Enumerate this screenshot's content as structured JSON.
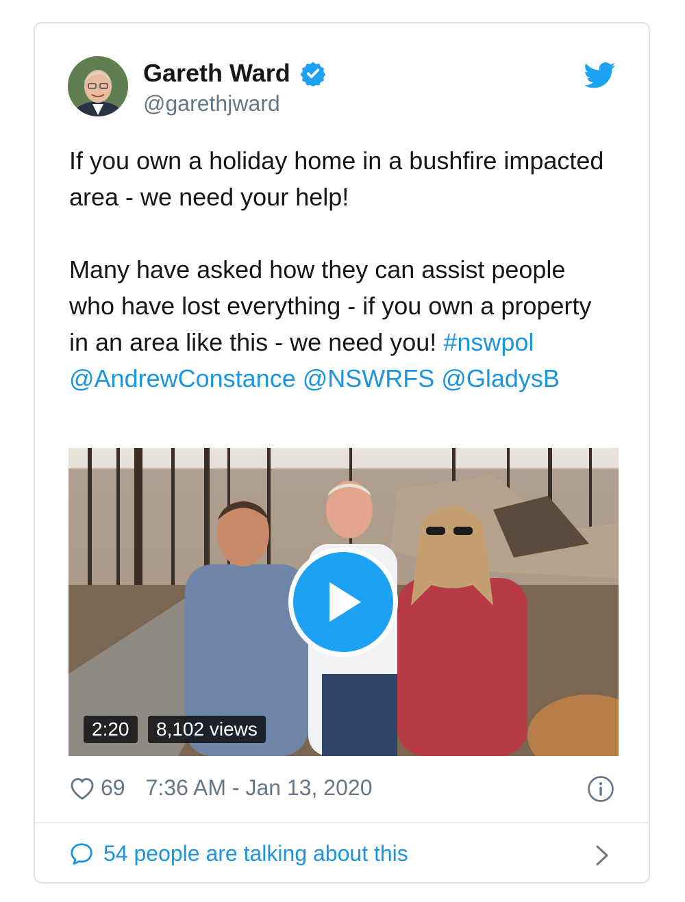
{
  "tweet": {
    "author": {
      "name": "Gareth Ward",
      "handle": "@garethjward",
      "verified": true
    },
    "text": {
      "paragraph1": "If you own a holiday home in a bushfire impacted area - we need your help!",
      "paragraph2": "Many have asked how they can assist people who have lost everything - if you own a property in an area like this - we need you!",
      "hashtag": "#nswpol",
      "mentions": [
        "@AndrewConstance",
        "@NSWRFS",
        "@GladysB"
      ]
    },
    "video": {
      "duration": "2:20",
      "views": "8,102 views"
    },
    "likes": "69",
    "timestamp": "7:36 AM - Jan 13, 2020",
    "conversation": "54 people are talking about this"
  },
  "icons": {
    "bird": "twitter-bird-icon",
    "verified": "verified-badge-icon",
    "heart": "heart-icon",
    "info": "info-icon",
    "comment": "comment-bubble-icon",
    "chevron": "chevron-right-icon",
    "play": "play-icon"
  },
  "colors": {
    "brand_blue": "#1da1f2",
    "link_blue": "#1b95e0",
    "text": "#14171a",
    "secondary_text": "#657786",
    "border": "#dfe3e6"
  }
}
